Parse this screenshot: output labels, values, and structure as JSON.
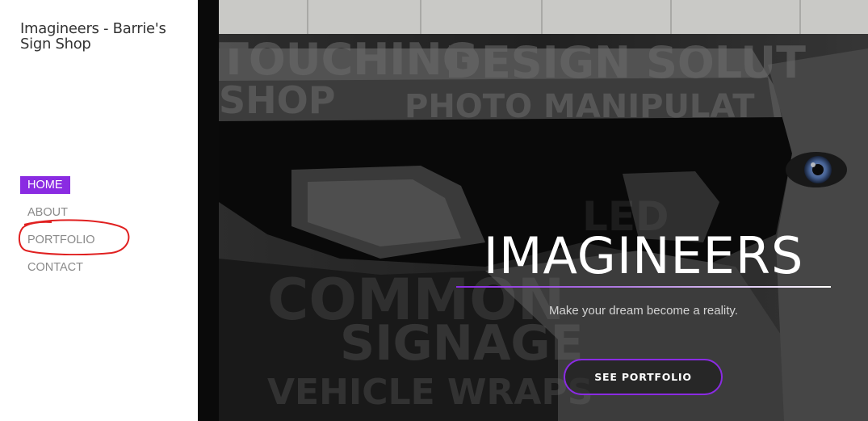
{
  "site": {
    "title": "Imagineers - Barrie's Sign Shop"
  },
  "nav": {
    "items": [
      {
        "label": "HOME",
        "active": true
      },
      {
        "label": "ABOUT",
        "active": false
      },
      {
        "label": "PORTFOLIO",
        "active": false
      },
      {
        "label": "CONTACT",
        "active": false
      }
    ]
  },
  "hero": {
    "title": "IMAGINEERS",
    "subtitle": "Make your dream become a reality.",
    "cta_label": "SEE PORTFOLIO",
    "background_words": [
      "TOUCHING",
      "DESIGN SOLUT",
      "SHOP",
      "PHOTO MANIPULAT",
      "COMMON",
      "SIGNAGE",
      "VEHICLE WRAPS",
      "LED"
    ]
  },
  "colors": {
    "accent": "#8a2be2",
    "annotation": "#e02020",
    "eye": "#5b7fc0"
  }
}
